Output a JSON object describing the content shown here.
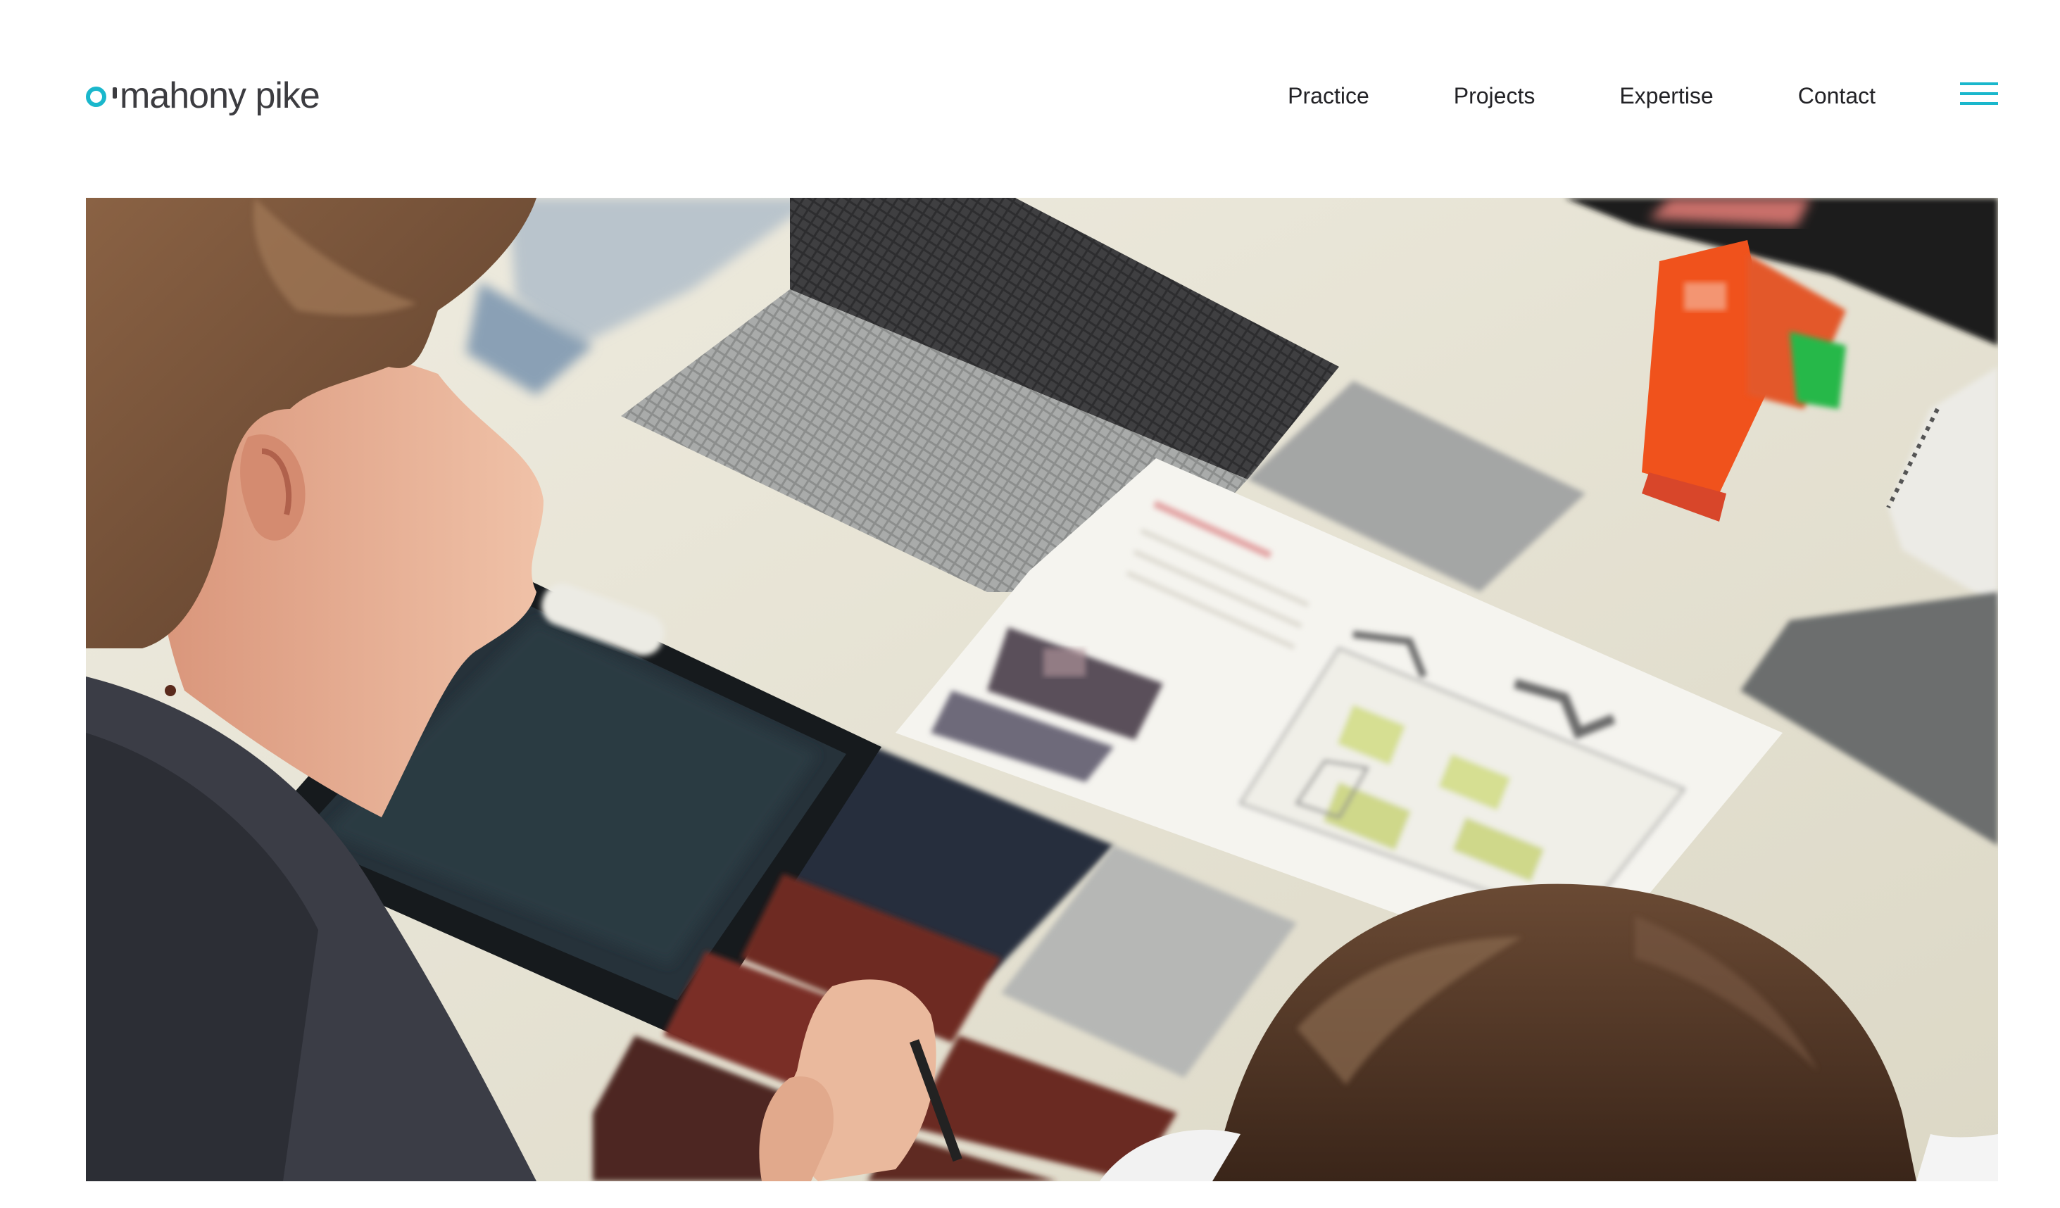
{
  "brand": {
    "name": "mahony pike",
    "accent_color": "#1ab7cc",
    "text_color": "#3c3c40",
    "logo_mark": "o-ring-icon"
  },
  "nav": {
    "items": [
      {
        "label": "Practice"
      },
      {
        "label": "Projects"
      },
      {
        "label": "Expertise"
      },
      {
        "label": "Contact"
      }
    ],
    "menu_icon": "hamburger-menu-icon"
  },
  "hero": {
    "kind": "photo",
    "palette": {
      "table": "#e9e6d6",
      "hair": "#6b4a33",
      "skin": "#e3aa8d",
      "jacket": "#3b3d46",
      "tray": "#26323a",
      "brick": "#6e2b22",
      "tile_dark": "#3f3f41",
      "tile_light": "#a4a6a5",
      "swatch_orange": "#f0521c"
    }
  }
}
